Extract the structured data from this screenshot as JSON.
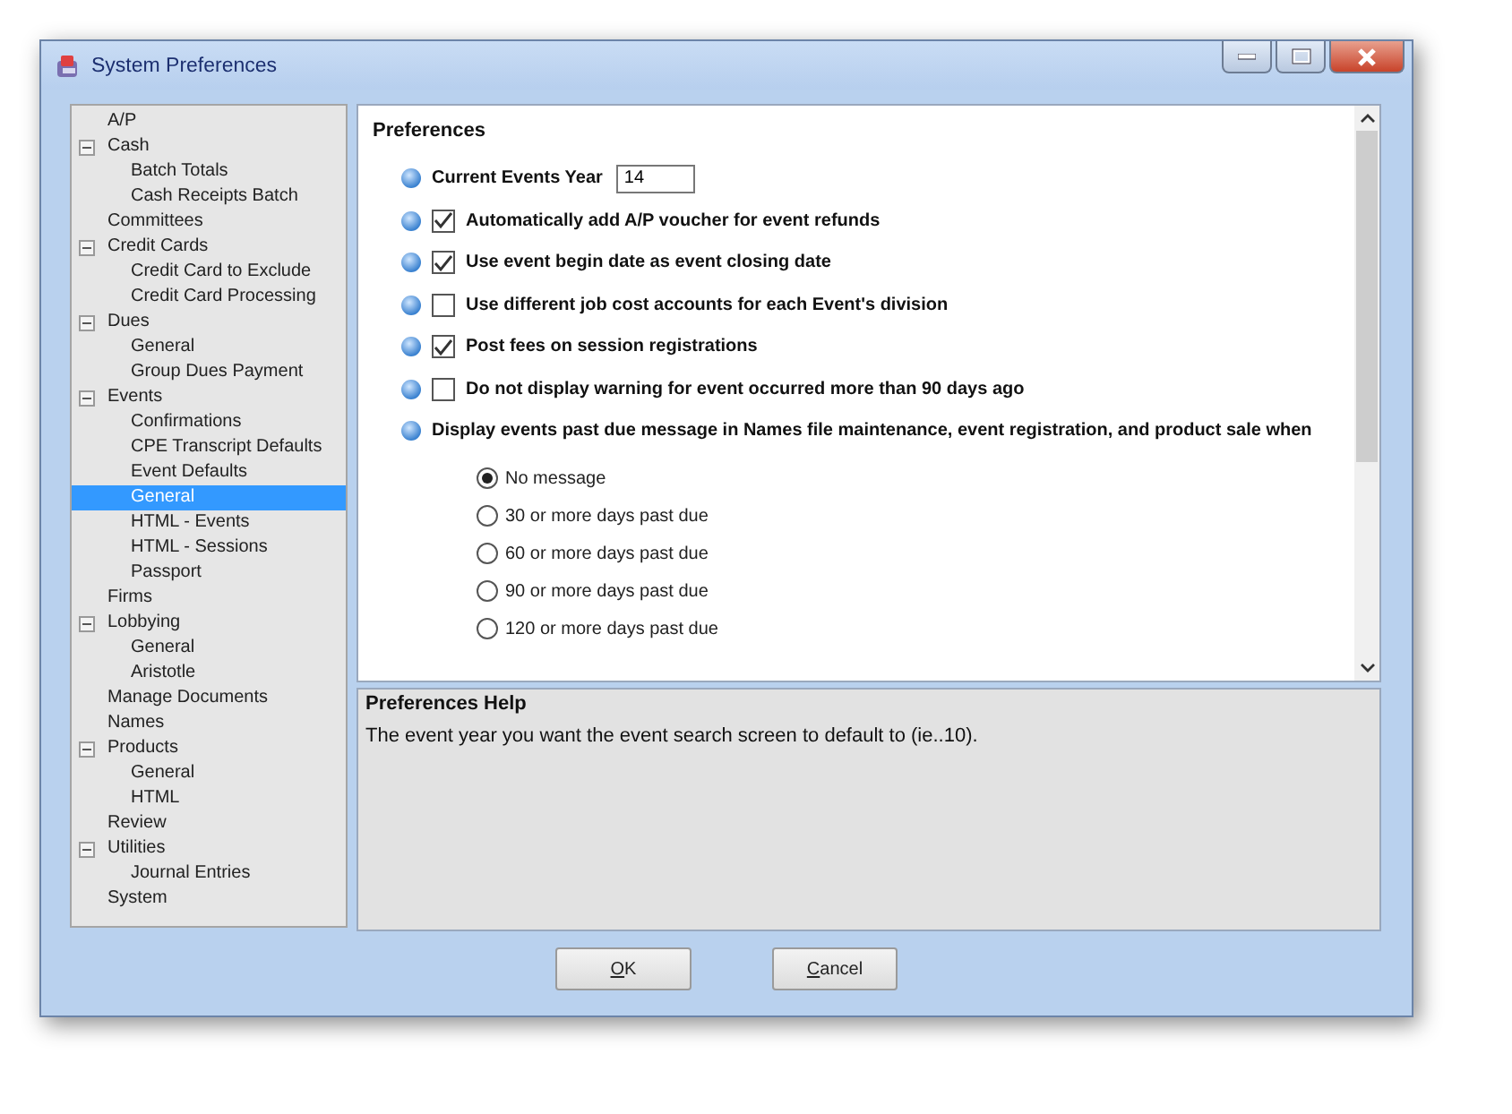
{
  "window": {
    "title": "System Preferences"
  },
  "tree": [
    {
      "label": "A/P",
      "selected": false
    },
    {
      "label": "Cash",
      "selected": false,
      "expanded": true,
      "children": [
        {
          "label": "Batch Totals",
          "selected": false
        },
        {
          "label": "Cash Receipts Batch",
          "selected": false
        }
      ]
    },
    {
      "label": "Committees",
      "selected": false
    },
    {
      "label": "Credit Cards",
      "selected": false,
      "expanded": true,
      "children": [
        {
          "label": "Credit Card to Exclude",
          "selected": false
        },
        {
          "label": "Credit Card Processing",
          "selected": false
        }
      ]
    },
    {
      "label": "Dues",
      "selected": false,
      "expanded": true,
      "children": [
        {
          "label": "General",
          "selected": false
        },
        {
          "label": "Group Dues Payment",
          "selected": false
        }
      ]
    },
    {
      "label": "Events",
      "selected": false,
      "expanded": true,
      "children": [
        {
          "label": "Confirmations",
          "selected": false
        },
        {
          "label": "CPE Transcript Defaults",
          "selected": false
        },
        {
          "label": "Event Defaults",
          "selected": false
        },
        {
          "label": "General",
          "selected": true
        },
        {
          "label": "HTML - Events",
          "selected": false
        },
        {
          "label": "HTML - Sessions",
          "selected": false
        },
        {
          "label": "Passport",
          "selected": false
        }
      ]
    },
    {
      "label": "Firms",
      "selected": false
    },
    {
      "label": "Lobbying",
      "selected": false,
      "expanded": true,
      "children": [
        {
          "label": "General",
          "selected": false
        },
        {
          "label": "Aristotle",
          "selected": false
        }
      ]
    },
    {
      "label": "Manage Documents",
      "selected": false
    },
    {
      "label": "Names",
      "selected": false
    },
    {
      "label": "Products",
      "selected": false,
      "expanded": true,
      "children": [
        {
          "label": "General",
          "selected": false
        },
        {
          "label": "HTML",
          "selected": false
        }
      ]
    },
    {
      "label": "Review",
      "selected": false
    },
    {
      "label": "Utilities",
      "selected": false,
      "expanded": true,
      "children": [
        {
          "label": "Journal Entries",
          "selected": false
        }
      ]
    },
    {
      "label": "System",
      "selected": false
    }
  ],
  "preferences": {
    "title": "Preferences",
    "items": [
      {
        "kind": "field",
        "label": "Current Events Year",
        "value": "14"
      },
      {
        "kind": "checkbox",
        "label": "Automatically add A/P voucher for event refunds",
        "checked": true
      },
      {
        "kind": "checkbox",
        "label": "Use event begin date as event closing date",
        "checked": true
      },
      {
        "kind": "checkbox",
        "label": "Use different job cost accounts for each Event's division",
        "checked": false
      },
      {
        "kind": "checkbox",
        "label": "Post fees on session registrations",
        "checked": true
      },
      {
        "kind": "checkbox",
        "label": "Do not display warning for event occurred more than 90 days ago",
        "checked": false
      },
      {
        "kind": "radio-group",
        "label": "Display events past due message in Names file maintenance, event registration, and product sale when",
        "options": [
          {
            "label": "No message",
            "selected": true
          },
          {
            "label": "30 or more days past due",
            "selected": false
          },
          {
            "label": "60 or more days past due",
            "selected": false
          },
          {
            "label": "90 or more days past due",
            "selected": false
          },
          {
            "label": "120 or more days past due",
            "selected": false
          }
        ]
      }
    ]
  },
  "help": {
    "title": "Preferences Help",
    "text": "The event year you want the event search screen to default to (ie..10)."
  },
  "buttons": [
    "OK",
    "Cancel"
  ]
}
